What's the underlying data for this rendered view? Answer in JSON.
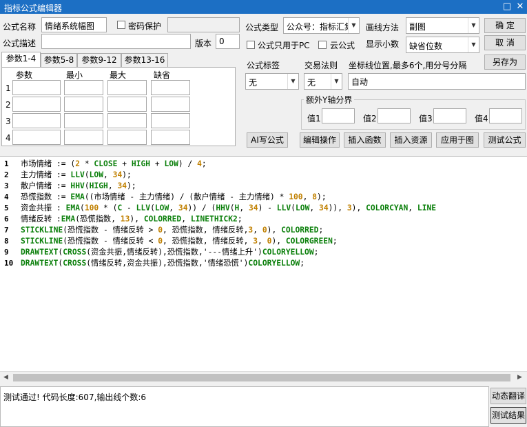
{
  "window": {
    "title": "指标公式编辑器",
    "minimize_label": "□",
    "close_label": "✕"
  },
  "form": {
    "name_label": "公式名称",
    "name_value": "情绪系统幅图",
    "password_label": "密码保护",
    "desc_label": "公式描述",
    "desc_value": "",
    "version_label": "版本",
    "version_value": "0",
    "type_label": "公式类型",
    "type_value": "公众号：指标汇集",
    "draw_label": "画线方法",
    "draw_value": "副图",
    "pc_only_label": "公式只用于PC",
    "cloud_label": "云公式",
    "decimals_label": "显示小数",
    "decimals_value": "缺省位数",
    "tag_label": "公式标签",
    "tag_value": "无",
    "trade_label": "交易法则",
    "trade_value": "无",
    "coord_label": "坐标线位置,最多6个,用分号分隔",
    "coord_value": "自动",
    "yaxis_group": "额外Y轴分界",
    "yaxis_values": [
      "值1",
      "值2",
      "值3",
      "值4"
    ]
  },
  "buttons": {
    "ok": "确 定",
    "cancel": "取 消",
    "save_as": "另存为",
    "ai": "AI写公式",
    "edit_ops": "编辑操作",
    "insert_func": "插入函数",
    "insert_res": "插入资源",
    "apply_chart": "应用于图",
    "test": "测试公式",
    "dyn_translate": "动态翻译",
    "test_result": "测试结果"
  },
  "tabs": [
    "参数1-4",
    "参数5-8",
    "参数9-12",
    "参数13-16"
  ],
  "param_headers": [
    "参数",
    "最小",
    "最大",
    "缺省"
  ],
  "param_rows": [
    "1",
    "2",
    "3",
    "4"
  ],
  "code_lines": [
    "市场情绪 := (2 * CLOSE + HIGH + LOW) / 4;",
    "主力情绪 := LLV(LOW, 34);",
    "散户情绪 := HHV(HIGH, 34);",
    "恐慌指数 := EMA((市场情绪 - 主力情绪) / (散户情绪 - 主力情绪) * 100, 8);",
    "资金共振 : EMA(100 * (C - LLV(LOW, 34)) / (HHV(H, 34) - LLV(LOW, 34)), 3), COLORCYAN, LINE",
    "情绪反转 :EMA(恐慌指数, 13), COLORRED, LINETHICK2;",
    "STICKLINE(恐慌指数 - 情绪反转 > 0, 恐慌指数, 情绪反转,3, 0), COLORRED;",
    "STICKLINE(恐慌指数 - 情绪反转 < 0, 恐慌指数, 情绪反转, 3, 0), COLORGREEN;",
    "DRAWTEXT(CROSS(资金共振,情绪反转),恐慌指数,'---情绪上升')COLORYELLOW;",
    "DRAWTEXT(CROSS(情绪反转,资金共振),恐慌指数,'情绪恐慌')COLORYELLOW;"
  ],
  "line_numbers": [
    "1",
    "2",
    "3",
    "4",
    "5",
    "6",
    "7",
    "8",
    "9",
    "10"
  ],
  "status_text": "测试通过! 代码长度:607,输出线个数:6",
  "colors": {
    "titlebar": "#1c6fc4",
    "keyword": "#0a7f0a",
    "number": "#c08000"
  }
}
